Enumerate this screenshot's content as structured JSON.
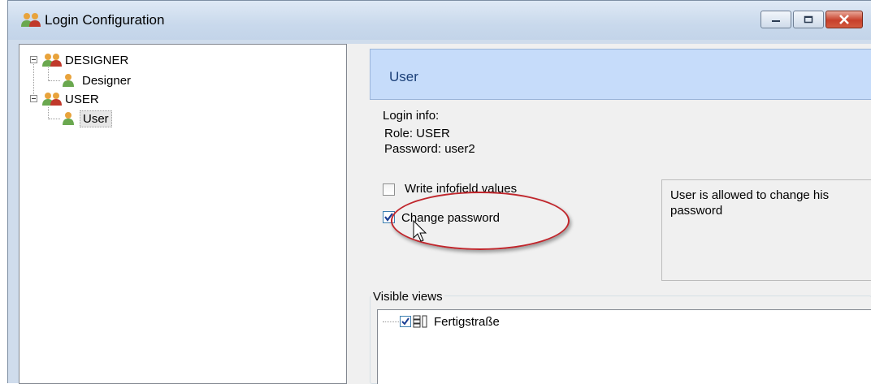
{
  "window": {
    "title": "Login Configuration",
    "icons": {
      "app": "users-group-icon",
      "minimize": "minimize-icon",
      "maximize": "maximize-icon",
      "close": "close-icon"
    }
  },
  "tree": {
    "groups": [
      {
        "label": "DESIGNER",
        "icon": "users-group-icon",
        "children": [
          {
            "label": "Designer",
            "icon": "user-icon"
          }
        ]
      },
      {
        "label": "USER",
        "icon": "users-group-icon",
        "children": [
          {
            "label": "User",
            "icon": "user-icon",
            "selected": true
          }
        ]
      }
    ]
  },
  "details": {
    "header": "User",
    "login_info_label": "Login info:",
    "role_line": "Role: USER",
    "password_line": "Password: user2",
    "options": [
      {
        "label": "Write infofield values",
        "checked": false
      },
      {
        "label": "Change password",
        "checked": true
      }
    ],
    "description": "User is allowed to change his password",
    "visible_views": {
      "legend": "Visible views",
      "items": [
        {
          "label": "Fertigstraße",
          "checked": true,
          "icon": "layout-view-icon"
        }
      ]
    }
  },
  "colors": {
    "header_band": "#c6dcfa",
    "highlight": "#c0262c",
    "close_button": "#c7402b"
  }
}
